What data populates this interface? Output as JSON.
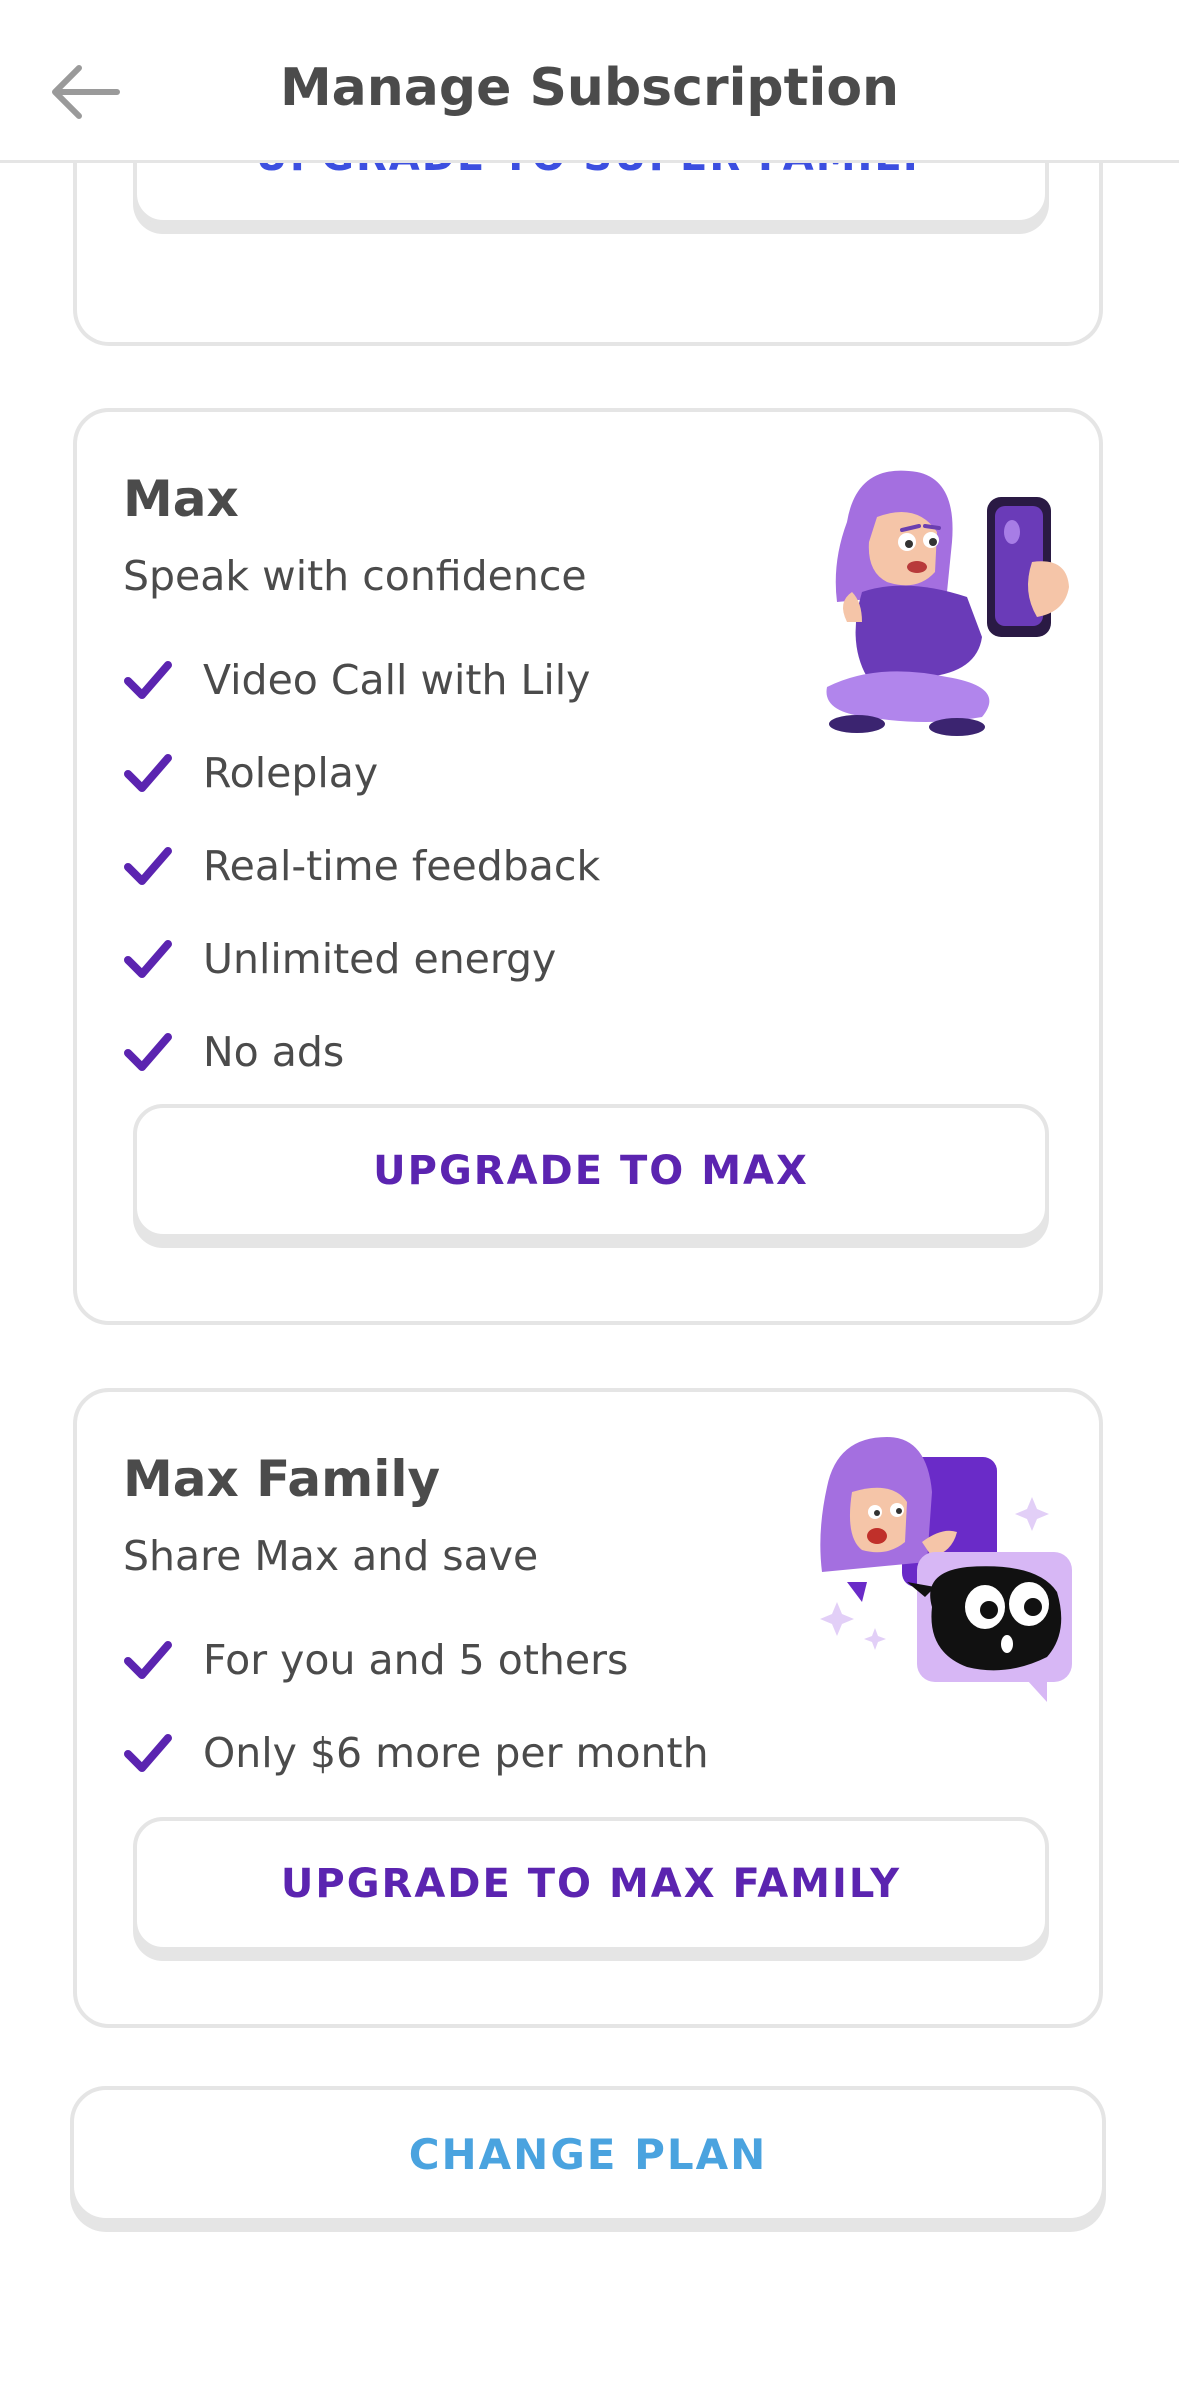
{
  "header": {
    "title": "Manage Subscription",
    "back_icon": "arrow-left-icon"
  },
  "super_family": {
    "button_label": "UPGRADE TO SUPER FAMILY",
    "button_color": "#3c4fe0"
  },
  "max": {
    "title": "Max",
    "subtitle": "Speak with confidence",
    "features": [
      "Video Call with Lily",
      "Roleplay",
      "Real-time feedback",
      "Unlimited energy",
      "No ads"
    ],
    "button_label": "UPGRADE TO MAX",
    "illustration": "lily-video-call-illustration"
  },
  "max_family": {
    "title": "Max Family",
    "subtitle": "Share Max and save",
    "features": [
      "For you and 5 others",
      "Only $6 more per month"
    ],
    "button_label": "UPGRADE TO MAX FAMILY",
    "illustration": "lily-and-friend-chat-illustration"
  },
  "change_plan": {
    "label": "CHANGE PLAN",
    "color": "#4aa3df"
  },
  "colors": {
    "max_purple": "#5b24b0",
    "check_purple": "#5b24b0",
    "border_gray": "#e5e5e5",
    "text_dark": "#4b4b4b"
  }
}
